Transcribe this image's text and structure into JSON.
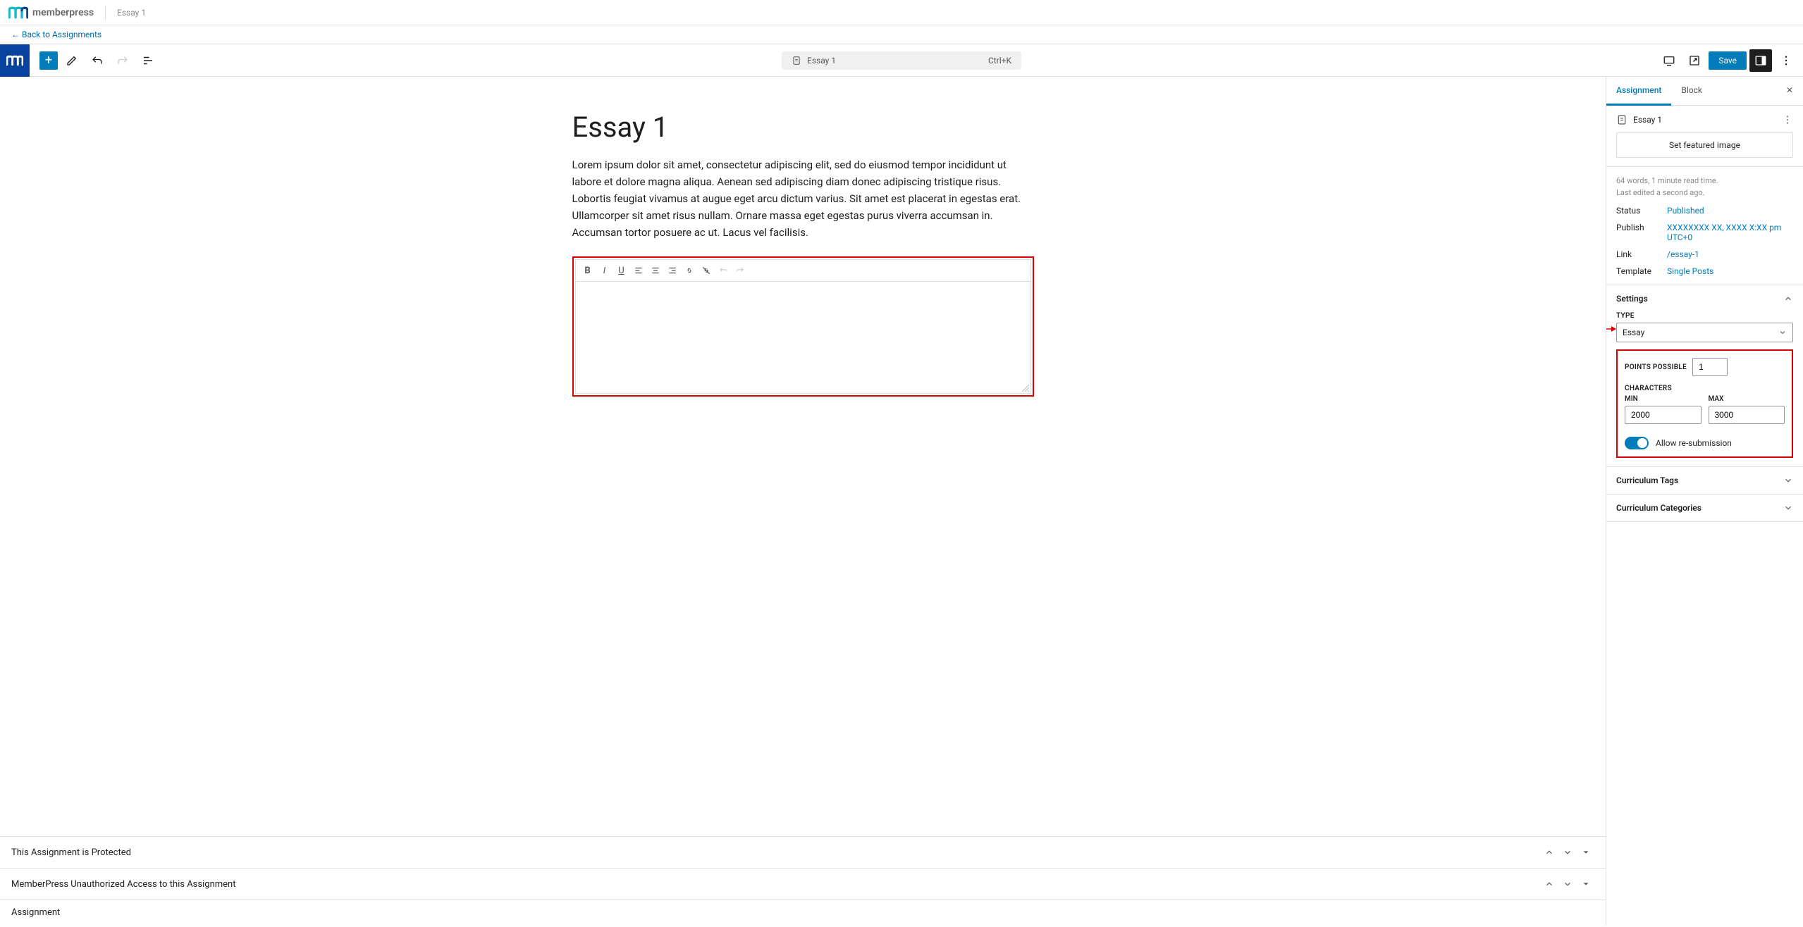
{
  "admin": {
    "brand": "memberpress",
    "title": "Essay 1",
    "back_link": "Back to Assignments"
  },
  "topbar": {
    "doc_title": "Essay 1",
    "shortcut": "Ctrl+K",
    "save_label": "Save"
  },
  "editor": {
    "title": "Essay 1",
    "body": "Lorem ipsum dolor sit amet, consectetur adipiscing elit, sed do eiusmod tempor incididunt ut labore et dolore magna aliqua. Aenean sed adipiscing diam donec adipiscing tristique risus. Lobortis feugiat vivamus at augue eget arcu dictum varius. Sit amet est placerat in egestas erat. Ullamcorper sit amet risus nullam. Ornare massa eget egestas purus viverra accumsan in. Accumsan tortor posuere ac ut. Lacus vel facilisis."
  },
  "bottom_panels": [
    "This Assignment is Protected",
    "MemberPress Unauthorized Access to this Assignment",
    "Assignment"
  ],
  "sidebar": {
    "tabs": {
      "assignment": "Assignment",
      "block": "Block"
    },
    "doc_title": "Essay 1",
    "featured_image": "Set featured image",
    "meta_line1": "64 words, 1 minute read time.",
    "meta_line2": "Last edited a second ago.",
    "status": {
      "label": "Status",
      "value": "Published"
    },
    "publish": {
      "label": "Publish",
      "value": "XXXXXXXX XX, XXXX X:XX pm UTC+0"
    },
    "link": {
      "label": "Link",
      "value": "/essay-1"
    },
    "template": {
      "label": "Template",
      "value": "Single Posts"
    },
    "settings_head": "Settings",
    "type_label": "TYPE",
    "type_value": "Essay",
    "points_label": "POINTS POSSIBLE",
    "points_value": "1",
    "chars_label": "CHARACTERS",
    "min_label": "MIN",
    "min_value": "2000",
    "max_label": "MAX",
    "max_value": "3000",
    "allow_resub": "Allow re-submission",
    "tags_head": "Curriculum Tags",
    "cats_head": "Curriculum Categories"
  }
}
